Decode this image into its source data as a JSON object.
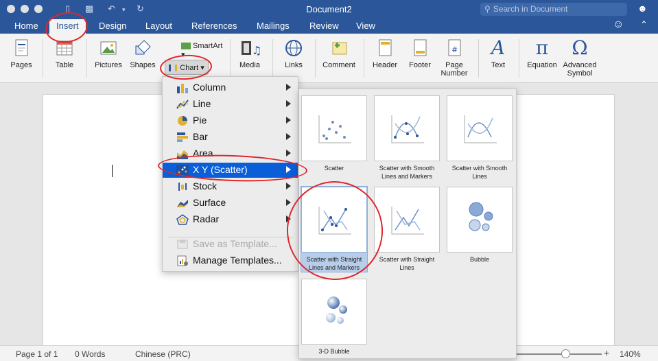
{
  "window": {
    "title": "Document2",
    "search_placeholder": "Search in Document"
  },
  "tabs": [
    "Home",
    "Insert",
    "Design",
    "Layout",
    "References",
    "Mailings",
    "Review",
    "View"
  ],
  "active_tab": "Insert",
  "ribbon": {
    "pages": "Pages",
    "table": "Table",
    "pictures": "Pictures",
    "shapes": "Shapes",
    "smartart": "SmartArt",
    "chart": "Chart",
    "media": "Media",
    "links": "Links",
    "comment": "Comment",
    "header": "Header",
    "footer": "Footer",
    "page_number_line1": "Page",
    "page_number_line2": "Number",
    "text": "Text",
    "equation": "Equation",
    "advanced_symbol_line1": "Advanced",
    "advanced_symbol_line2": "Symbol"
  },
  "chart_menu": {
    "items": [
      {
        "label": "Column",
        "icon": "column-chart-icon"
      },
      {
        "label": "Line",
        "icon": "line-chart-icon"
      },
      {
        "label": "Pie",
        "icon": "pie-chart-icon"
      },
      {
        "label": "Bar",
        "icon": "bar-chart-icon"
      },
      {
        "label": "Area",
        "icon": "area-chart-icon"
      },
      {
        "label": "X Y (Scatter)",
        "icon": "scatter-chart-icon"
      },
      {
        "label": "Stock",
        "icon": "stock-chart-icon"
      },
      {
        "label": "Surface",
        "icon": "surface-chart-icon"
      },
      {
        "label": "Radar",
        "icon": "radar-chart-icon"
      }
    ],
    "save_template": "Save as Template...",
    "manage_templates": "Manage Templates..."
  },
  "gallery": {
    "items": [
      {
        "label_1": "Scatter",
        "label_2": ""
      },
      {
        "label_1": "Scatter with Smooth",
        "label_2": "Lines and Markers"
      },
      {
        "label_1": "Scatter with Smooth",
        "label_2": "Lines"
      },
      {
        "label_1": "Scatter with Straight",
        "label_2": "Lines and Markers"
      },
      {
        "label_1": "Scatter with Straight",
        "label_2": "Lines"
      },
      {
        "label_1": "Bubble",
        "label_2": ""
      },
      {
        "label_1": "3-D Bubble",
        "label_2": ""
      }
    ]
  },
  "statusbar": {
    "page": "Page 1 of 1",
    "words": "0 Words",
    "language": "Chinese (PRC)",
    "zoom": "140%"
  },
  "colors": {
    "word_blue": "#2b579a",
    "selection_blue": "#0a5fd8",
    "annotation_red": "#e0262a"
  }
}
